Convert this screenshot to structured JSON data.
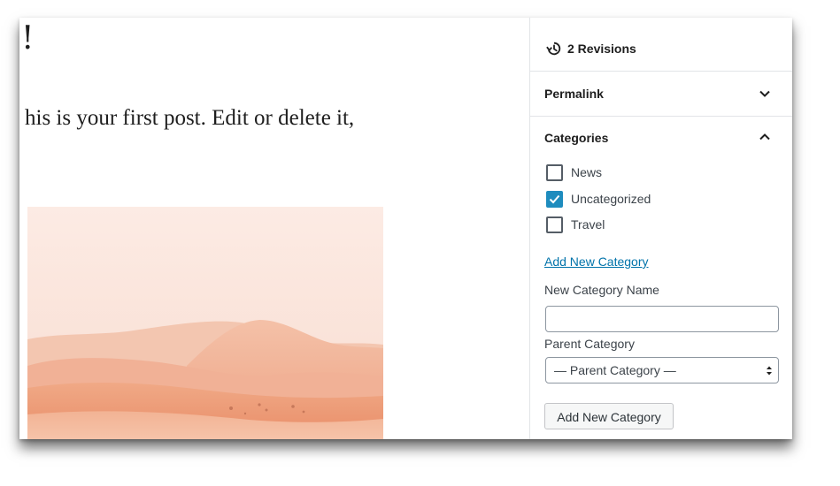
{
  "editor": {
    "title_fragment": "!",
    "paragraph": "his is your first post. Edit or delete it,",
    "image": {
      "description_icon": "desert-dunes-image",
      "colors": {
        "sky": "#fbe9e2",
        "dunes": "#f0a583"
      }
    }
  },
  "sidebar": {
    "revisions_label": "2 Revisions",
    "permalink_title": "Permalink",
    "categories_title": "Categories",
    "categories": [
      {
        "label": "News",
        "checked": false
      },
      {
        "label": "Uncategorized",
        "checked": true
      },
      {
        "label": "Travel",
        "checked": false
      }
    ],
    "add_new_category_link": "Add New Category",
    "new_category_name_label": "New Category Name",
    "new_category_name_value": "",
    "parent_category_label": "Parent Category",
    "parent_category_selected": "— Parent Category —",
    "add_new_category_button": "Add New Category"
  },
  "colors": {
    "accent": "#1e8cbe",
    "link": "#0073aa",
    "text": "#1e1e1e",
    "border": "#e2e4e7"
  }
}
